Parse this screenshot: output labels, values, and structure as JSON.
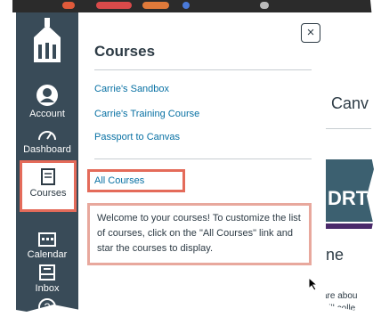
{
  "global_nav": {
    "items": [
      {
        "label": "Account",
        "icon": "account-avatar-icon"
      },
      {
        "label": "Dashboard",
        "icon": "dashboard-icon"
      },
      {
        "label": "Courses",
        "icon": "courses-book-icon"
      },
      {
        "label": "Calendar",
        "icon": "calendar-icon"
      },
      {
        "label": "Inbox",
        "icon": "inbox-icon"
      },
      {
        "label": "",
        "icon": "help-icon"
      }
    ]
  },
  "tray": {
    "title": "Courses",
    "close_symbol": "×",
    "courses": [
      "Carrie's Sandbox",
      "Carrie's Training Course",
      "Passport to Canvas"
    ],
    "all_courses": "All Courses",
    "note": "Welcome to your courses! To customize the list of courses, click on the \"All Courses\" link and star the courses to display."
  },
  "background": {
    "heading_fragment": "Canv",
    "banner_fragment": "DRT",
    "subheading_fragment": "ne",
    "body_fragment_1": "are abou",
    "body_fragment_2": "will colle"
  },
  "colors": {
    "nav_bg": "#394b58",
    "highlight": "#e46b5a",
    "link": "#0770a3",
    "text": "#2d3b45"
  }
}
